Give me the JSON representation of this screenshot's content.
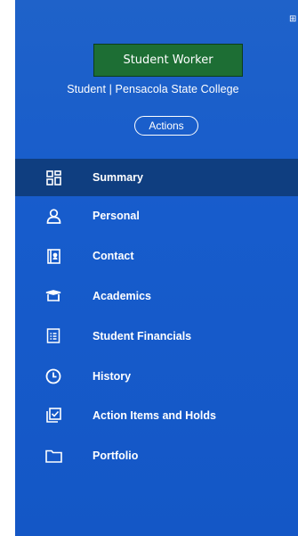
{
  "header": {
    "role_label": "Student Worker",
    "subtitle": "Student | Pensacola State College",
    "actions_label": "Actions",
    "corner_glyph": "⊞"
  },
  "colors": {
    "panel": "#1a5ecb",
    "active_row": "#0f3e80",
    "role_box": "#1d6e34",
    "text": "#ffffff"
  },
  "nav": {
    "items": [
      {
        "label": "Summary",
        "icon": "grid-icon",
        "active": true
      },
      {
        "label": "Personal",
        "icon": "person-icon",
        "active": false
      },
      {
        "label": "Contact",
        "icon": "contact-book-icon",
        "active": false
      },
      {
        "label": "Academics",
        "icon": "graduation-cap-icon",
        "active": false
      },
      {
        "label": "Student Financials",
        "icon": "ledger-icon",
        "active": false
      },
      {
        "label": "History",
        "icon": "clock-icon",
        "active": false
      },
      {
        "label": "Action Items and Holds",
        "icon": "checklist-icon",
        "active": false
      },
      {
        "label": "Portfolio",
        "icon": "folder-icon",
        "active": false
      }
    ]
  }
}
